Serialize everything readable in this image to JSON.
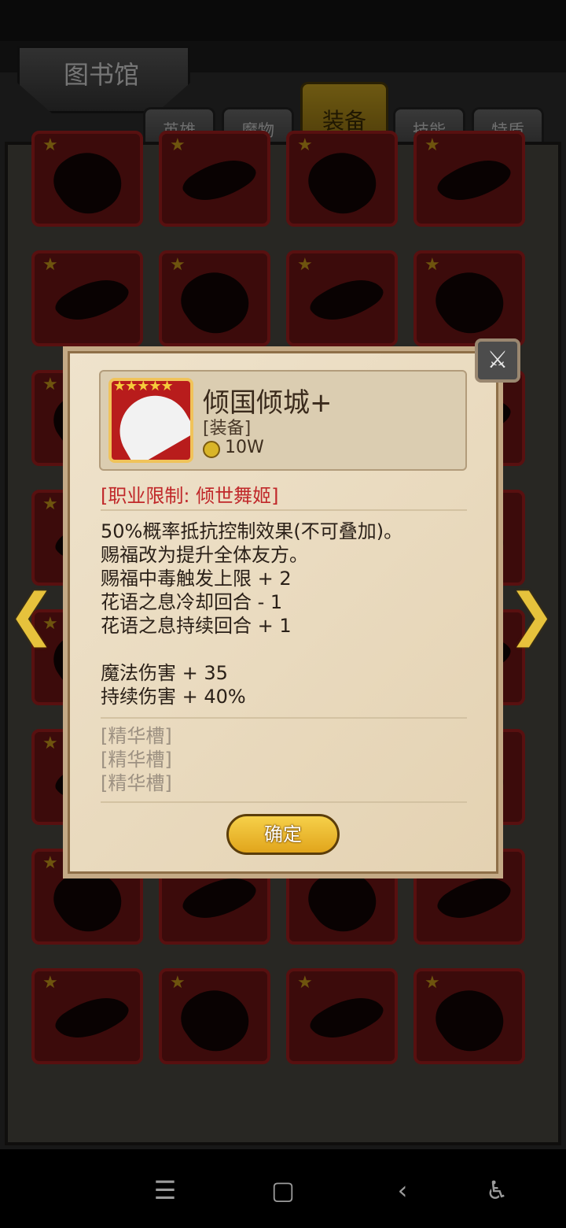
{
  "library": {
    "title": "图书馆",
    "tabs": [
      {
        "label": "英雄",
        "active": false
      },
      {
        "label": "魔物",
        "active": false
      },
      {
        "label": "装备",
        "active": true
      },
      {
        "label": "技能",
        "active": false
      },
      {
        "label": "特质",
        "active": false
      }
    ]
  },
  "dialog": {
    "item": {
      "name": "倾国倾城+",
      "type": "[装备]",
      "price": "10W",
      "stars": "★★★★★"
    },
    "restriction": "[职业限制: 倾世舞姬]",
    "effects": [
      "50%概率抵抗控制效果(不可叠加)。",
      "赐福改为提升全体友方。",
      "赐福中毒触发上限 + 2",
      "花语之息冷却回合 - 1",
      "花语之息持续回合 + 1"
    ],
    "stats": [
      "魔法伤害 + 35",
      "持续伤害 + 40%"
    ],
    "slots": [
      "[精华槽]",
      "[精华槽]",
      "[精华槽]"
    ],
    "confirm_label": "确定"
  },
  "colors": {
    "accent_gold": "#e1a51c",
    "restriction_red": "#c0282a",
    "cell_red": "#6e1414"
  }
}
